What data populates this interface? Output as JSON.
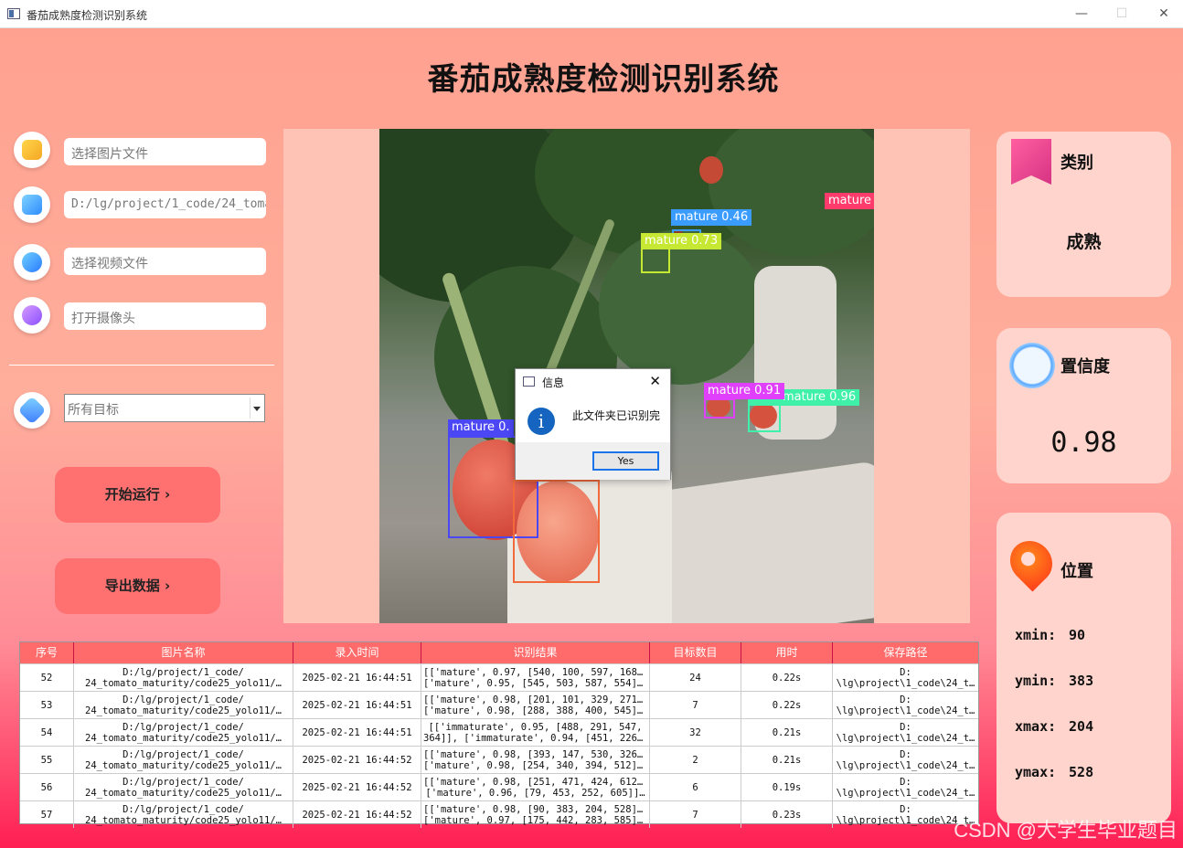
{
  "window": {
    "title": "番茄成熟度检测识别系统",
    "min_glyph": "—",
    "max_glyph": "☐",
    "close_glyph": "✕"
  },
  "app_title": "番茄成熟度检测识别系统",
  "inputs": {
    "image": {
      "placeholder": "选择图片文件"
    },
    "folder": {
      "value": "D:/lg/project/1_code/24_tomato_maturity/code25_yolo11/"
    },
    "video": {
      "placeholder": "选择视频文件"
    },
    "camera": {
      "placeholder": "打开摄像头"
    }
  },
  "target_select": {
    "value": "所有目标"
  },
  "buttons": {
    "run": "开始运行 ›",
    "export": "导出数据 ›"
  },
  "detections": [
    {
      "label": "mature 0.46",
      "color": "#3b9cff"
    },
    {
      "label": "mature 0.73",
      "color": "#c7e832"
    },
    {
      "label": "mature",
      "color": "#ff3b6b"
    },
    {
      "label": "mature 0.91",
      "color": "#e040fb"
    },
    {
      "label": "mature 0.96",
      "color": "#3ef0a8"
    },
    {
      "label": "mature 0.",
      "color": "#4b47f5"
    },
    {
      "label": "",
      "color": "#f26a3b"
    }
  ],
  "dialog": {
    "title": "信息",
    "message": "此文件夹已识别完",
    "yes": "Yes",
    "close": "✕",
    "icon": "i"
  },
  "cards": {
    "category": {
      "title": "类别",
      "value": "成熟"
    },
    "confidence": {
      "title": "置信度",
      "value": "0.98"
    },
    "position": {
      "title": "位置",
      "xmin_label": "xmin:",
      "xmin": "90",
      "ymin_label": "ymin:",
      "ymin": "383",
      "xmax_label": "xmax:",
      "xmax": "204",
      "ymax_label": "ymax:",
      "ymax": "528"
    }
  },
  "table": {
    "headers": [
      "序号",
      "图片名称",
      "录入时间",
      "识别结果",
      "目标数目",
      "用时",
      "保存路径"
    ],
    "rows": [
      {
        "id": "52",
        "name1": "D:/lg/project/1_code/",
        "name2": "24_tomato_maturity/code25_yolo11/…",
        "time": "2025-02-21 16:44:51",
        "res1": "[['mature', 0.97, [540, 100, 597, 168]],",
        "res2": "['mature', 0.95, [545, 503, 587, 554]]…",
        "count": "24",
        "dur": "0.22s",
        "path1": "D:",
        "path2": "\\lg\\project\\1_code\\24_t…"
      },
      {
        "id": "53",
        "name1": "D:/lg/project/1_code/",
        "name2": "24_tomato_maturity/code25_yolo11/…",
        "time": "2025-02-21 16:44:51",
        "res1": "[['mature', 0.98, [201, 101, 329, 271]],",
        "res2": "['mature', 0.98, [288, 388, 400, 545]]…",
        "count": "7",
        "dur": "0.22s",
        "path1": "D:",
        "path2": "\\lg\\project\\1_code\\24_t…"
      },
      {
        "id": "54",
        "name1": "D:/lg/project/1_code/",
        "name2": "24_tomato_maturity/code25_yolo11/…",
        "time": "2025-02-21 16:44:51",
        "res1": "[['immaturate', 0.95, [488, 291, 547,",
        "res2": "364]], ['immaturate', 0.94, [451, 226,…",
        "count": "32",
        "dur": "0.21s",
        "path1": "D:",
        "path2": "\\lg\\project\\1_code\\24_t…"
      },
      {
        "id": "55",
        "name1": "D:/lg/project/1_code/",
        "name2": "24_tomato_maturity/code25_yolo11/…",
        "time": "2025-02-21 16:44:52",
        "res1": "[['mature', 0.98, [393, 147, 530, 326]],",
        "res2": "['mature', 0.98, [254, 340, 394, 512]]]",
        "count": "2",
        "dur": "0.21s",
        "path1": "D:",
        "path2": "\\lg\\project\\1_code\\24_t…"
      },
      {
        "id": "56",
        "name1": "D:/lg/project/1_code/",
        "name2": "24_tomato_maturity/code25_yolo11/…",
        "time": "2025-02-21 16:44:52",
        "res1": "[['mature', 0.98, [251, 471, 424, 612]],",
        "res2": "['mature', 0.96, [79, 453, 252, 605]]…",
        "count": "6",
        "dur": "0.19s",
        "path1": "D:",
        "path2": "\\lg\\project\\1_code\\24_t…"
      },
      {
        "id": "57",
        "name1": "D:/lg/project/1_code/",
        "name2": "24_tomato_maturity/code25_yolo11/…",
        "time": "2025-02-21 16:44:52",
        "res1": "[['mature', 0.98, [90, 383, 204, 528]],",
        "res2": "['mature', 0.97, [175, 442, 283, 585]]…",
        "count": "7",
        "dur": "0.23s",
        "path1": "D:",
        "path2": "\\lg\\project\\1_code\\24_t…"
      }
    ]
  },
  "watermark": "CSDN @大学生毕业题目"
}
